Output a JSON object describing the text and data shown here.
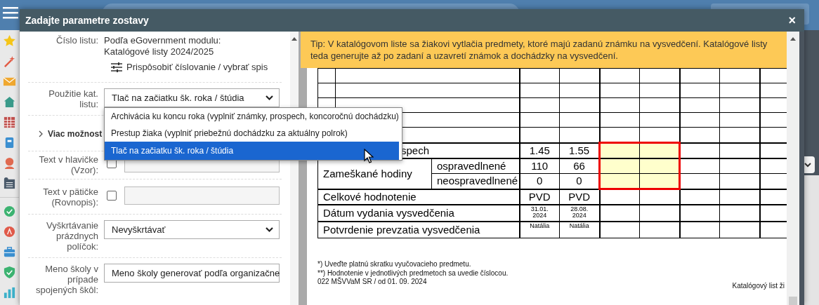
{
  "dialog": {
    "title": "Zadajte parametre zostavy",
    "close": "×"
  },
  "form": {
    "rows": [
      {
        "kind": "info",
        "label": [
          "Číslo listu:"
        ],
        "lines": [
          "Podľa eGovernment modulu:",
          "Katalógové listy 2024/2025"
        ],
        "link": "Prispôsobiť číslovanie / vybrať spis"
      },
      {
        "kind": "select",
        "label": [
          "Použitie kat.",
          "listu:"
        ],
        "value": "Tlač na začiatku šk. roka / štúdia",
        "open": true,
        "options": [
          {
            "label": "Archivácia ku koncu roka (vyplniť známky, prospech, koncoročnú dochádzku)",
            "selected": false
          },
          {
            "label": "Prestup žiaka (vyplniť priebežnú dochádzku za aktuálny polrok)",
            "selected": false
          },
          {
            "label": "Tlač na začiatku šk. roka / štúdia",
            "selected": true
          }
        ]
      },
      {
        "kind": "expander",
        "label": [
          "Viac možnost"
        ],
        "expanded": false
      },
      {
        "kind": "check_input",
        "label": [
          "Text v hlavičke",
          "(Vzor):"
        ],
        "checked": false
      },
      {
        "kind": "check_input",
        "label": [
          "Text v pätičke",
          "(Rovnopis):"
        ],
        "checked": false
      },
      {
        "kind": "select",
        "label": [
          "Vyškrtávanie",
          "prázdnych",
          "políčok:"
        ],
        "value": "Nevyškrtávať"
      },
      {
        "kind": "select",
        "label": [
          "Meno školy v",
          "prípade",
          "spojených škôl:"
        ],
        "value": "Meno školy generovať podľa organizačne"
      }
    ]
  },
  "preview": {
    "tip": "Tip: V katalógovom liste sa žiakovi vytlačia predmety, ktoré majú zadanú známku na vysvedčení. Katalógové listy teda generujte až po zadaní a uzavretí známok a dochádzky na vysvedčení.",
    "table": {
      "rows": [
        {
          "kind": "blank"
        },
        {
          "kind": "blank"
        },
        {
          "kind": "blank"
        },
        {
          "kind": "blank"
        },
        {
          "kind": "blank"
        },
        {
          "kind": "single",
          "label": "spech",
          "values": [
            "1.45",
            "1.55"
          ],
          "highlight": true
        },
        {
          "kind": "group",
          "label": "Zameškané hodiny",
          "highlight": true,
          "sub": [
            {
              "label": "ospravedlnené",
              "values": [
                "110",
                "66"
              ]
            },
            {
              "label": "neospravedlnené",
              "values": [
                "0",
                "0"
              ]
            }
          ]
        },
        {
          "kind": "single",
          "label": "Celkové hodnotenie",
          "values": [
            "PVD",
            "PVD"
          ],
          "highlight": false
        },
        {
          "kind": "date",
          "label": "Dátum vydania vysvedčenia",
          "values": [
            "31.01. 2024",
            "28.08. 2024"
          ],
          "highlight": false
        },
        {
          "kind": "sign",
          "label": "Potvrdenie prevzatia vysvedčenia",
          "values": [
            "Natália",
            "Natália"
          ],
          "highlight": false
        }
      ]
    },
    "footnotes": [
      "*) Uveďte platnú skratku vyučovacieho predmetu.",
      "**) Hodnotenie v jednotlivých predmetoch sa uvedie číslocou.",
      "022 MŠVVaM SR / od 01. 09. 2024"
    ],
    "footer_right": "Katalógový list ži"
  }
}
